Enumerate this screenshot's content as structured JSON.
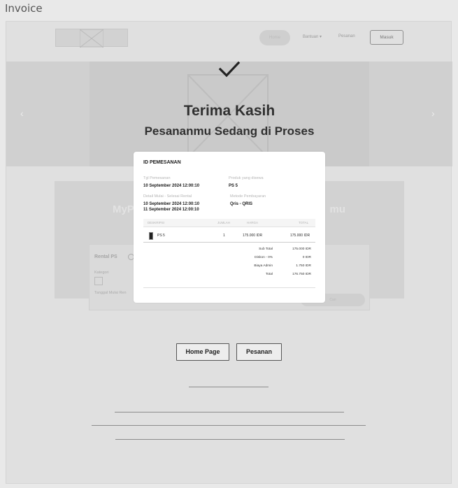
{
  "frame": {
    "title": "Invoice"
  },
  "background": {
    "nav": {
      "active_label": "Home",
      "links": [
        "Bantuan ▾",
        "Pesanan"
      ],
      "login_label": "Masuk"
    },
    "hero": {
      "prev_arrow": "‹",
      "next_arrow": "›"
    },
    "promo": {
      "title_left": "MyP",
      "title_right": "mu"
    },
    "rental": {
      "title": "Rental PS",
      "category_label": "Kategori",
      "date_label": "Tanggal Mulai Ren",
      "submit_label": "Cari"
    }
  },
  "thanks": {
    "title": "Terima Kasih",
    "subtitle": "Pesananmu Sedang di Proses"
  },
  "invoice": {
    "id_label": "ID PEMESANAN",
    "order_date_label": "Tgl Pemesanan",
    "order_date": "10 September 2024 12:00:10",
    "product_label": "Produk yang disewa",
    "product": "PS 5",
    "rental_period_label": "Detail Mulai - Selesai Rental",
    "rental_start": "10 September 2024 12:00:10",
    "rental_end": "11 September 2024 12:00:10",
    "payment_label": "Metode Pembayaran",
    "payment": "Qris - QRIS",
    "table": {
      "headers": [
        "DESKRIPSI",
        "JUMLAH",
        "HARGA",
        "TOTAL"
      ],
      "rows": [
        {
          "item": "PS 5",
          "qty": "1",
          "price": "175.000 IDR",
          "total": "175.000 IDR"
        }
      ]
    },
    "summary": [
      {
        "label": "Sub Total",
        "value": "175.000 IDR"
      },
      {
        "label": "Diskon - 0%",
        "value": "0 IDR"
      },
      {
        "label": "Biaya Admin",
        "value": "1.750 IDR"
      },
      {
        "label": "Total",
        "value": "176.750 IDR"
      }
    ]
  },
  "actions": {
    "home_label": "Home Page",
    "orders_label": "Pesanan"
  },
  "icons": {
    "check": "check-icon",
    "ps": "console-icon"
  },
  "colors": {
    "page_bg": "#e0e0e0",
    "modal_bg": "#ffffff",
    "text": "#303030"
  }
}
